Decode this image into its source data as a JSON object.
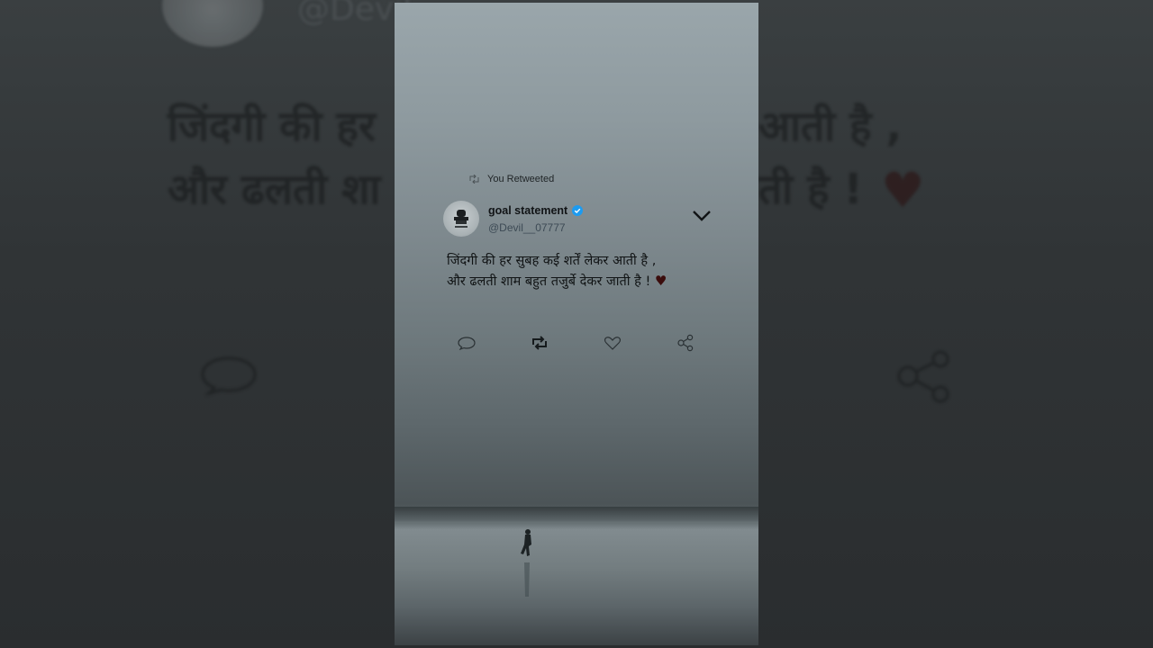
{
  "retweet_label": "You Retweeted",
  "tweet": {
    "display_name": "goal statement",
    "handle": "@Devil__07777",
    "line1": "जिंदगी की हर सुबह कई शर्तें लेकर आती है ,",
    "line2": "और ढलती शाम बहुत तजुर्बे देकर जाती है !",
    "heart": "♥",
    "verified": true,
    "retweeted": true
  },
  "background": {
    "handle": "@Devil",
    "line1_left": "जिंदगी की हर",
    "line1_right": "आती है ,",
    "line2_left": "और ढलती शा",
    "line2_right": "ती है !",
    "heart": "♥"
  },
  "icons": {
    "retweet_small": "retweet-icon",
    "verified": "verified-badge-icon",
    "more": "chevron-down-icon",
    "reply": "comment-icon",
    "retweet": "retweet-icon",
    "like": "heart-icon",
    "share": "share-icon",
    "avatar": "emblem-icon"
  },
  "colors": {
    "verified_blue": "#1d9bf0",
    "heart": "#3b0c0c",
    "text": "#101314",
    "handle": "#3d4a55"
  }
}
